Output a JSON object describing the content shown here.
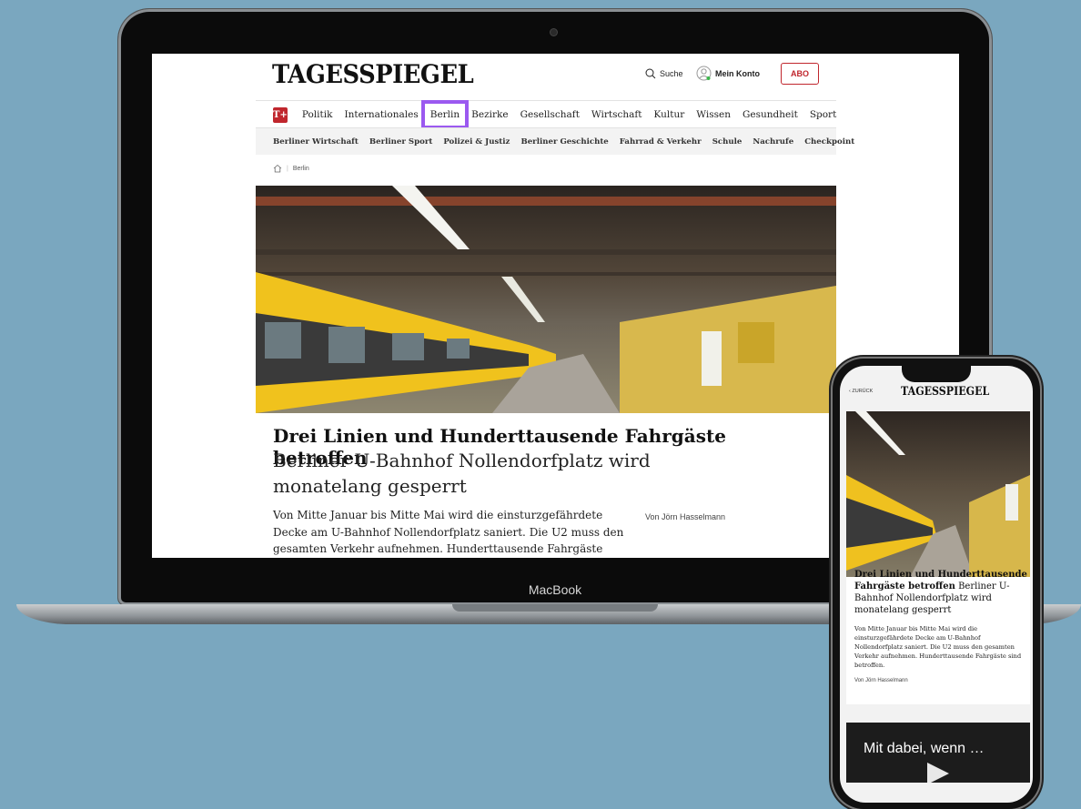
{
  "colors": {
    "background": "#7aa7bf",
    "brand_red": "#c0262d",
    "highlight": "#9b59f0"
  },
  "laptop": {
    "bezel_label": "MacBook",
    "site": {
      "logo": "TAGESSPIEGEL",
      "header": {
        "search": "Suche",
        "account": "Mein Konto",
        "abo": "ABO"
      },
      "tplus": "T+",
      "nav_main": [
        "Politik",
        "Internationales",
        "Berlin",
        "Bezirke",
        "Gesellschaft",
        "Wirtschaft",
        "Kultur",
        "Wissen",
        "Gesundheit",
        "Sport"
      ],
      "nav_sub": [
        "Berliner Wirtschaft",
        "Berliner Sport",
        "Polizei & Justiz",
        "Berliner Geschichte",
        "Fahrrad & Verkehr",
        "Schule",
        "Nachrufe",
        "Checkpoint"
      ],
      "breadcrumb": "Berlin",
      "article": {
        "headline": "Drei Linien und Hunderttausende Fahrgäste betroffen",
        "subhead": "Berliner U-Bahnhof Nollendorfplatz wird monatelang gesperrt",
        "teaser": "Von Mitte Januar bis Mitte Mai wird die einsturzgefährdete Decke am U-Bahnhof Nollendorfplatz saniert. Die U2 muss den gesamten Verkehr aufnehmen. Hunderttausende Fahrgäste sind betroffen.",
        "byline": "Von Jörn Hasselmann"
      }
    }
  },
  "phone": {
    "back": "ZURÜCK",
    "logo": "TAGESSPIEGEL",
    "headline_bold": "Drei Linien und Hunderttausende Fahrgäste betroffen",
    "headline_rest": "Berliner U-Bahnhof Nollendorfplatz wird monatelang gesperrt",
    "teaser": "Von Mitte Januar bis Mitte Mai wird die einsturzgefährdete Decke am U-Bahnhof Nollendorfplatz saniert. Die U2 muss den gesamten Verkehr aufnehmen. Hunderttausende Fahrgäste sind betroffen.",
    "byline": "Von Jörn Hasselmann",
    "video_label": "Mit dabei, wenn …"
  }
}
